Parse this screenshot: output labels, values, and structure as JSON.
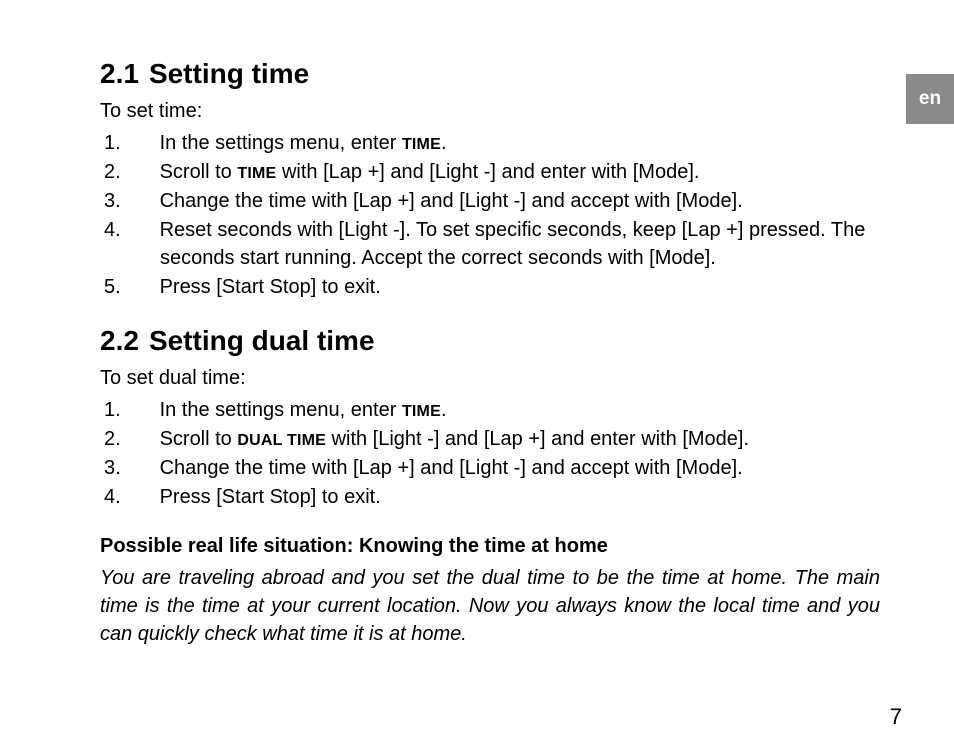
{
  "lang_tab": "en",
  "section1": {
    "number": "2.1",
    "title": "Setting time",
    "intro": "To set time:",
    "steps": [
      {
        "n": "1.",
        "pre": "In the settings menu, enter ",
        "sc": "TIME",
        "post": "."
      },
      {
        "n": "2.",
        "pre": "Scroll to ",
        "sc": "TIME",
        "post": " with [Lap +] and [Light -] and enter with [Mode]."
      },
      {
        "n": "3.",
        "text": "Change the time with [Lap +] and [Light -] and accept with [Mode]."
      },
      {
        "n": "4.",
        "text": "Reset seconds with [Light -]. To set specific seconds, keep [Lap +] pressed. The seconds start running. Accept the correct seconds with [Mode]."
      },
      {
        "n": "5.",
        "text": "Press [Start Stop] to exit."
      }
    ]
  },
  "section2": {
    "number": "2.2",
    "title": "Setting dual time",
    "intro": "To set dual time:",
    "steps": [
      {
        "n": "1.",
        "pre": "In the settings menu, enter ",
        "sc": "TIME",
        "post": "."
      },
      {
        "n": "2.",
        "pre": "Scroll to ",
        "sc": "DUAL TIME",
        "post": " with [Light -] and [Lap +] and enter with [Mode]."
      },
      {
        "n": "3.",
        "text": "Change the time with [Lap +] and [Light -] and accept with [Mode]."
      },
      {
        "n": "4.",
        "text": "Press [Start Stop] to exit."
      }
    ]
  },
  "subhead": "Possible real life situation: Knowing the time at home",
  "scenario": "You are traveling abroad and you set the dual time to be the time at home. The main time is the time at your current location. Now you always know the local time and you can quickly check what time it is at home.",
  "page_number": "7"
}
